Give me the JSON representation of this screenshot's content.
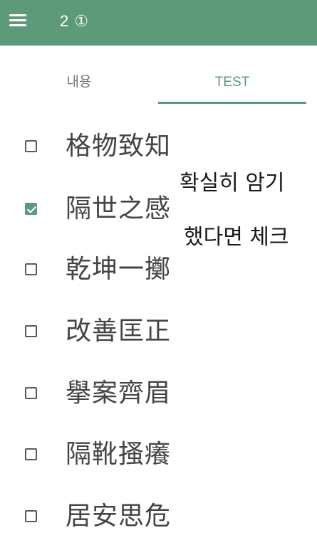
{
  "appbar": {
    "title": "2 ①",
    "menu_icon": "hamburger-menu-icon",
    "color": "#5c9a7a"
  },
  "tabs": [
    {
      "label": "내용",
      "active": false
    },
    {
      "label": "TEST",
      "active": true
    }
  ],
  "items": [
    {
      "text": "格物致知",
      "checked": false
    },
    {
      "text": "隔世之感",
      "checked": true
    },
    {
      "text": "乾坤一擲",
      "checked": false
    },
    {
      "text": "改善匡正",
      "checked": false
    },
    {
      "text": "擧案齊眉",
      "checked": false
    },
    {
      "text": "隔靴搔癢",
      "checked": false
    },
    {
      "text": "居安思危",
      "checked": false
    }
  ],
  "annotation": {
    "line1": "확실히 암기",
    "line2": "했다면 체크"
  },
  "colors": {
    "accent": "#5c9a7a",
    "text": "#444444",
    "tab_inactive": "#777777"
  }
}
